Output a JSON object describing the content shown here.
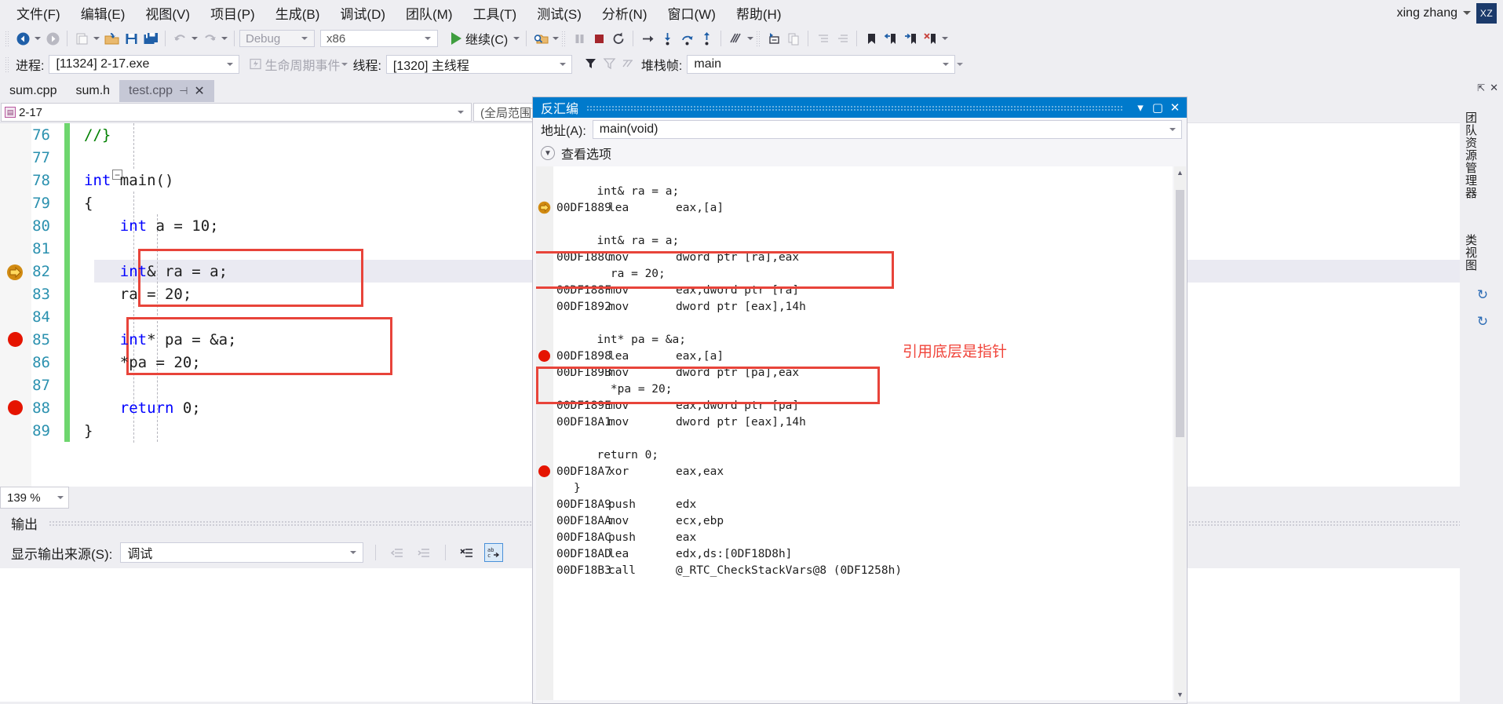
{
  "app": {
    "user_name": "xing zhang",
    "avatar_initials": "XZ",
    "accent_blue": "#007acc",
    "breakpoint_red": "#e51400",
    "annotation_red": "#e8443a"
  },
  "menubar": {
    "items": [
      {
        "label": "文件(F)"
      },
      {
        "label": "编辑(E)"
      },
      {
        "label": "视图(V)"
      },
      {
        "label": "项目(P)"
      },
      {
        "label": "生成(B)"
      },
      {
        "label": "调试(D)"
      },
      {
        "label": "团队(M)"
      },
      {
        "label": "工具(T)"
      },
      {
        "label": "测试(S)"
      },
      {
        "label": "分析(N)"
      },
      {
        "label": "窗口(W)"
      },
      {
        "label": "帮助(H)"
      }
    ]
  },
  "toolbar": {
    "config_value": "Debug",
    "platform_value": "x86",
    "continue_label": "继续(C)",
    "icons": [
      "navigate-back-icon",
      "navigate-forward-icon",
      "new-item-icon",
      "open-file-icon",
      "save-icon",
      "save-all-icon",
      "undo-icon",
      "redo-icon",
      "start-debug-icon",
      "find-icon",
      "pause-icon",
      "stop-icon",
      "restart-icon",
      "show-next-statement-icon",
      "step-into-icon",
      "step-over-icon",
      "step-out-icon",
      "threads-icon",
      "new-window-icon",
      "copy-icon",
      "indent-icon",
      "outdent-icon",
      "bookmark-icon",
      "prev-bookmark-icon",
      "next-bookmark-icon",
      "clear-bookmarks-icon"
    ]
  },
  "context_bar": {
    "process_label": "进程:",
    "process_value": "[11324] 2-17.exe",
    "lifecycle_label": "生命周期事件",
    "thread_label": "线程:",
    "thread_value": "[1320] 主线程",
    "stackframe_label": "堆栈帧:",
    "stackframe_value": "main"
  },
  "editor": {
    "tabs": [
      {
        "label": "sum.cpp",
        "active": false
      },
      {
        "label": "sum.h",
        "active": false
      },
      {
        "label": "test.cpp",
        "active": true
      }
    ],
    "pin_glyph": "⊣",
    "close_glyph": "✕",
    "project_scope": "2-17",
    "member_scope": "(全局范围)",
    "zoom_level": "139 %",
    "lines": [
      {
        "no": "76",
        "text": "//}",
        "kind": "comment",
        "indent": 0,
        "marker": "none"
      },
      {
        "no": "77",
        "text": "",
        "kind": "plain",
        "indent": 0,
        "marker": "none"
      },
      {
        "no": "78",
        "text": "int main()",
        "kind": "decl",
        "indent": 0,
        "marker": "none"
      },
      {
        "no": "79",
        "text": "{",
        "kind": "plain",
        "indent": 0,
        "marker": "none"
      },
      {
        "no": "80",
        "text": "int a = 10;",
        "kind": "decl",
        "indent": 1,
        "marker": "none"
      },
      {
        "no": "81",
        "text": "",
        "kind": "plain",
        "indent": 0,
        "marker": "none"
      },
      {
        "no": "82",
        "text": "int& ra = a;",
        "kind": "decl",
        "indent": 1,
        "marker": "current"
      },
      {
        "no": "83",
        "text": "ra = 20;",
        "kind": "plain",
        "indent": 1,
        "marker": "none"
      },
      {
        "no": "84",
        "text": "",
        "kind": "plain",
        "indent": 0,
        "marker": "none"
      },
      {
        "no": "85",
        "text": "int* pa = &a;",
        "kind": "decl",
        "indent": 1,
        "marker": "breakpoint"
      },
      {
        "no": "86",
        "text": "*pa = 20;",
        "kind": "plain",
        "indent": 1,
        "marker": "none"
      },
      {
        "no": "87",
        "text": "",
        "kind": "plain",
        "indent": 0,
        "marker": "none"
      },
      {
        "no": "88",
        "text": "return 0;",
        "kind": "ret",
        "indent": 1,
        "marker": "breakpoint"
      },
      {
        "no": "89",
        "text": "}",
        "kind": "plain",
        "indent": 0,
        "marker": "none"
      }
    ]
  },
  "disassembly": {
    "window_title": "反汇编",
    "address_label": "地址(A):",
    "address_value": "main(void)",
    "view_options_label": "查看选项",
    "minimize_glyph": "▾",
    "maximize_glyph": "▢",
    "close_glyph": "✕",
    "rows": [
      {
        "type": "blank"
      },
      {
        "type": "source",
        "text": "int& ra = a;"
      },
      {
        "type": "code",
        "addr": "00DF1889",
        "mn": "lea",
        "op": "eax,[a]",
        "marker": "current"
      },
      {
        "type": "blank"
      },
      {
        "type": "source",
        "text": "int& ra = a;"
      },
      {
        "type": "code",
        "addr": "00DF188C",
        "mn": "mov",
        "op": "dword ptr [ra],eax",
        "marker": "none"
      },
      {
        "type": "source",
        "text": "ra = 20;",
        "indent": 1
      },
      {
        "type": "code",
        "addr": "00DF188F",
        "mn": "mov",
        "op": "eax,dword ptr [ra]",
        "marker": "none"
      },
      {
        "type": "code",
        "addr": "00DF1892",
        "mn": "mov",
        "op": "dword ptr [eax],14h",
        "marker": "none"
      },
      {
        "type": "blank"
      },
      {
        "type": "source",
        "text": "int* pa = &a;"
      },
      {
        "type": "code",
        "addr": "00DF1898",
        "mn": "lea",
        "op": "eax,[a]",
        "marker": "breakpoint"
      },
      {
        "type": "code",
        "addr": "00DF189B",
        "mn": "mov",
        "op": "dword ptr [pa],eax",
        "marker": "none"
      },
      {
        "type": "source",
        "text": "*pa = 20;",
        "indent": 1
      },
      {
        "type": "code",
        "addr": "00DF189E",
        "mn": "mov",
        "op": "eax,dword ptr [pa]",
        "marker": "none"
      },
      {
        "type": "code",
        "addr": "00DF18A1",
        "mn": "mov",
        "op": "dword ptr [eax],14h",
        "marker": "none"
      },
      {
        "type": "blank"
      },
      {
        "type": "source",
        "text": "return 0;"
      },
      {
        "type": "code",
        "addr": "00DF18A7",
        "mn": "xor",
        "op": "eax,eax",
        "marker": "breakpoint"
      },
      {
        "type": "source",
        "text": "}",
        "indent": -1
      },
      {
        "type": "code",
        "addr": "00DF18A9",
        "mn": "push",
        "op": "edx",
        "marker": "none"
      },
      {
        "type": "code",
        "addr": "00DF18AA",
        "mn": "mov",
        "op": "ecx,ebp",
        "marker": "none"
      },
      {
        "type": "code",
        "addr": "00DF18AC",
        "mn": "push",
        "op": "eax",
        "marker": "none"
      },
      {
        "type": "code",
        "addr": "00DF18AD",
        "mn": "lea",
        "op": "edx,ds:[0DF18D8h]",
        "marker": "none"
      },
      {
        "type": "code",
        "addr": "00DF18B3",
        "mn": "call",
        "op": "@_RTC_CheckStackVars@8 (0DF1258h)",
        "marker": "none"
      }
    ],
    "annotation_note": "引用底层是指针"
  },
  "output": {
    "title": "输出",
    "source_label": "显示输出来源(S):",
    "source_value": "调试"
  },
  "right_dock": {
    "tabs": [
      {
        "label": "团队资源管理器"
      },
      {
        "label": "类视图"
      }
    ]
  }
}
